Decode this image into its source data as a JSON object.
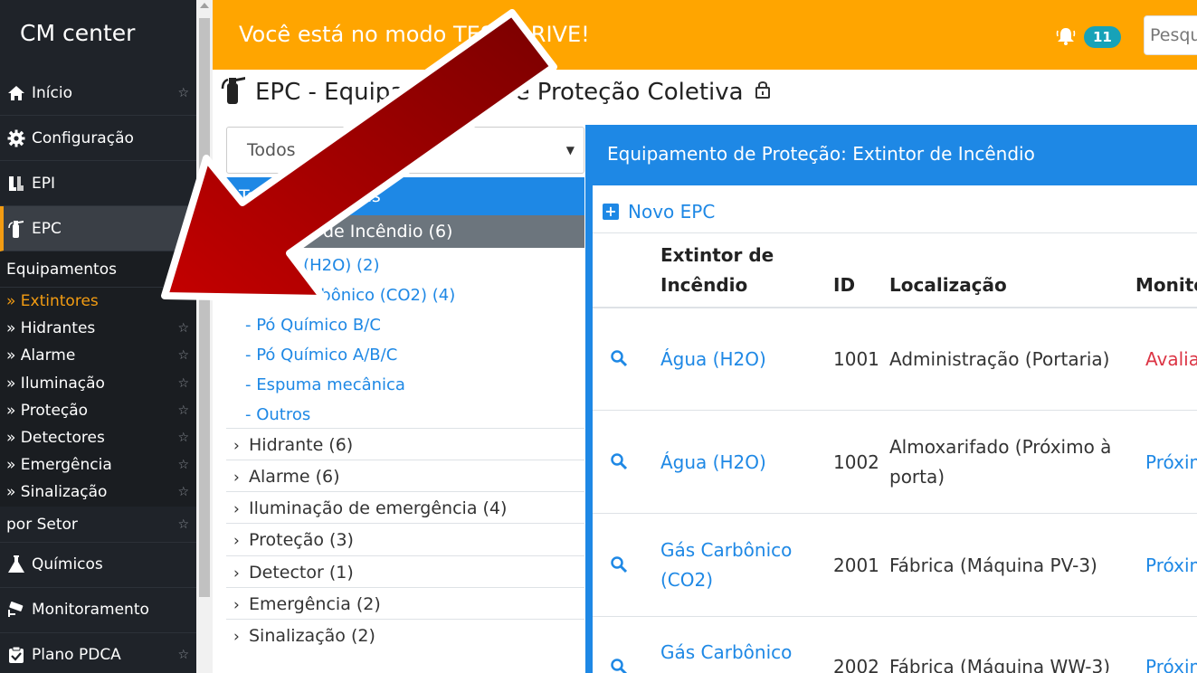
{
  "sidebar": {
    "brand": "CM center",
    "top_items": [
      {
        "label": "Início",
        "icon": "home-icon"
      },
      {
        "label": "Configuração",
        "icon": "gear-icon"
      },
      {
        "label": "EPI",
        "icon": "boots-icon"
      },
      {
        "label": "EPC",
        "icon": "extinguisher-icon"
      }
    ],
    "sub_title": "Equipamentos",
    "sub_items": [
      {
        "label": "» Extintores"
      },
      {
        "label": "» Hidrantes"
      },
      {
        "label": "» Alarme"
      },
      {
        "label": "» Iluminação"
      },
      {
        "label": "» Proteção"
      },
      {
        "label": "» Detectores"
      },
      {
        "label": "» Emergência"
      },
      {
        "label": "» Sinalização"
      }
    ],
    "sector": "por Setor",
    "bottom_items": [
      {
        "label": "Químicos",
        "icon": "flask-icon"
      },
      {
        "label": "Monitoramento",
        "icon": "camera-icon"
      },
      {
        "label": "Plano PDCA",
        "icon": "checklist-icon"
      }
    ],
    "star": "☆"
  },
  "topbar": {
    "message": "Você está no modo TEST DRIVE!",
    "notification_count": "11",
    "search_placeholder": "Pesquisar"
  },
  "page": {
    "title": "EPC - Equipamentos de Proteção Coletiva"
  },
  "filter": {
    "selected": "Todos",
    "caret": "▼"
  },
  "tree": {
    "header": "Todos os setores",
    "active": "Extintor de Incêndio (6)",
    "subitems": [
      "- Água (H2O) (2)",
      "- Gás Carbônico (CO2) (4)",
      "- Pó Químico B/C",
      "- Pó Químico A/B/C",
      "- Espuma mecânica",
      "- Outros"
    ],
    "categories": [
      "Hidrante (6)",
      "Alarme (6)",
      "Iluminação de emergência (4)",
      "Proteção (3)",
      "Detector (1)",
      "Emergência (2)",
      "Sinalização (2)"
    ],
    "chevron": "›"
  },
  "right": {
    "title": "Equipamento de Proteção: Extintor de Incêndio",
    "new_button": "Novo EPC",
    "plus": "+",
    "columns": {
      "type_line1": "Extintor de",
      "type_line2": "Incêndio",
      "id": "ID",
      "location": "Localização",
      "monitoring": "Monitoramento"
    },
    "rows": [
      {
        "type1": "Água (H2O)",
        "type2": "",
        "id": "1001",
        "loc1": "Administração (Portaria)",
        "loc2": "",
        "status": "Avaliação",
        "status_color": "#dc3545"
      },
      {
        "type1": "Água (H2O)",
        "type2": "",
        "id": "1002",
        "loc1": "Almoxarifado (Próximo à",
        "loc2": "porta)",
        "status": "Próximo",
        "status_color": "#1e88e5"
      },
      {
        "type1": "Gás Carbônico",
        "type2": "(CO2)",
        "id": "2001",
        "loc1": "Fábrica (Máquina PV-3)",
        "loc2": "",
        "status": "Próximo",
        "status_color": "#1e88e5"
      },
      {
        "type1": "Gás Carbônico",
        "type2": "",
        "id": "2002",
        "loc1": "Fábrica (Máquina WW-3)",
        "loc2": "",
        "status": "Próximo",
        "status_color": "#1e88e5"
      }
    ]
  },
  "colors": {
    "topbar": "#ffa500",
    "sidebar": "#1f2329",
    "accent": "#f39c12",
    "primary": "#1e88e5",
    "arrow": "#b00000"
  }
}
